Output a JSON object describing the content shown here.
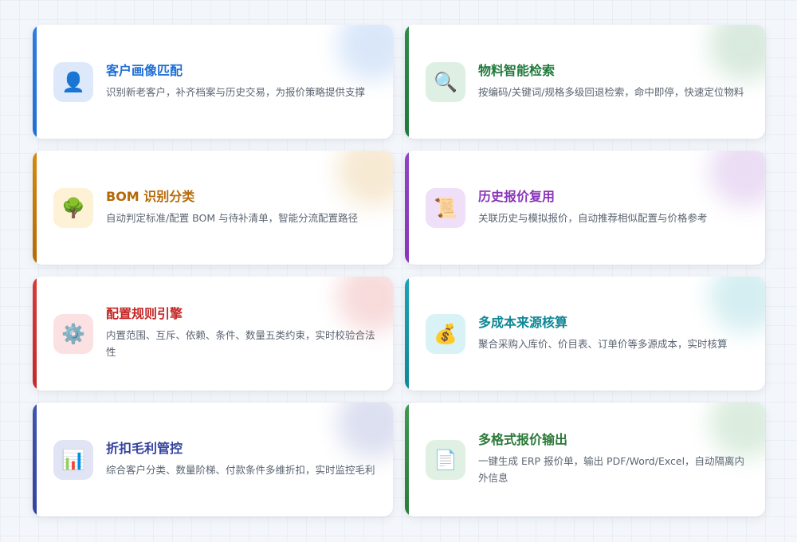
{
  "cards": [
    {
      "title": "客户画像匹配",
      "desc": "识别新老客户，补齐档案与历史交易，为报价策略提供支撑",
      "icon": "👤",
      "icon_name": "user-icon",
      "accent": "#2f7de1",
      "title_color": "#1f6fd6",
      "icon_bg": "#dde9fb"
    },
    {
      "title": "物料智能检索",
      "desc": "按编码/关键词/规格多级回退检索，命中即停，快速定位物料",
      "icon": "🔍",
      "icon_name": "search-icon",
      "accent": "#2e8b47",
      "title_color": "#1f7a3b",
      "icon_bg": "#def0e3"
    },
    {
      "title": "BOM 识别分类",
      "desc": "自动判定标准/配置 BOM 与待补清单，智能分流配置路径",
      "icon": "🌳",
      "icon_name": "tree-icon",
      "accent": "#d48a0c",
      "title_color": "#b56a06",
      "icon_bg": "#fdf1d6"
    },
    {
      "title": "历史报价复用",
      "desc": "关联历史与模拟报价，自动推荐相似配置与价格参考",
      "icon": "📜",
      "icon_name": "scroll-icon",
      "accent": "#8e44c4",
      "title_color": "#8a35b8",
      "icon_bg": "#efdff8"
    },
    {
      "title": "配置规则引擎",
      "desc": "内置范围、互斥、依赖、条件、数量五类约束，实时校验合法性",
      "icon": "⚙️",
      "icon_name": "gear-icon",
      "accent": "#d63b3b",
      "title_color": "#c62828",
      "icon_bg": "#fbe1e1"
    },
    {
      "title": "多成本来源核算",
      "desc": "聚合采购入库价、价目表、订单价等多源成本，实时核算",
      "icon": "💰",
      "icon_name": "money-bag-icon",
      "accent": "#1aa3b5",
      "title_color": "#0e8796",
      "icon_bg": "#d9f2f6"
    },
    {
      "title": "折扣毛利管控",
      "desc": "综合客户分类、数量阶梯、付款条件多维折扣，实时监控毛利",
      "icon": "📊",
      "icon_name": "bar-chart-icon",
      "accent": "#4253b0",
      "title_color": "#33429e",
      "icon_bg": "#e1e4f4"
    },
    {
      "title": "多格式报价输出",
      "desc": "一键生成 ERP 报价单，输出 PDF/Word/Excel，自动隔离内外信息",
      "icon": "📄",
      "icon_name": "document-icon",
      "accent": "#3e9a4f",
      "title_color": "#2b7a38",
      "icon_bg": "#e0f1e3"
    }
  ]
}
